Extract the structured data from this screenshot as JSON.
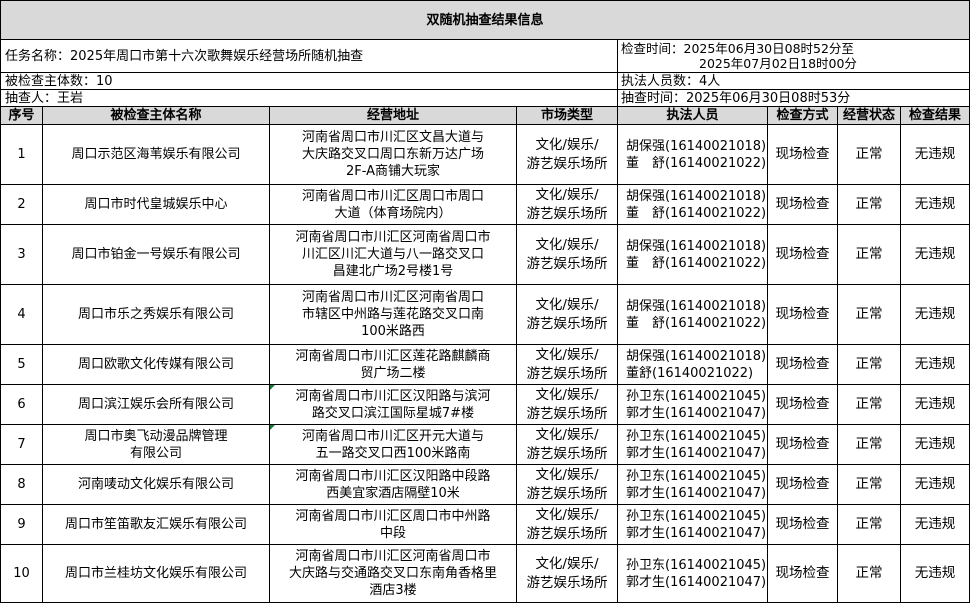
{
  "title": "双随机抽查结果信息",
  "info": {
    "task": "任务名称：2025年周口市第十六次歌舞娱乐经营场所随机抽查",
    "check_time_line1": "检查时间：2025年06月30日08时52分至",
    "check_time_line2": "2025年07月02日18时00分",
    "subjects": "被检查主体数：10",
    "officers": "执法人员数：4人",
    "drawer": "抽查人：王岩",
    "draw_time": "抽查时间：2025年06月30日08时53分"
  },
  "columns": [
    "序号",
    "被检查主体名称",
    "经营地址",
    "市场类型",
    "执法人员",
    "检查方式",
    "经营状态",
    "检查结果"
  ],
  "rows": [
    {
      "no": "1",
      "name": "周口示范区海苇娱乐有限公司",
      "addr": [
        "河南省周口市川汇区文昌大道与",
        "大庆路交叉口周口东新万达广场",
        "2F-A商铺大玩家"
      ],
      "market": [
        "文化/娱乐/",
        "游艺娱乐场所"
      ],
      "officers": [
        "胡保强(16140021018)",
        "董　舒(16140021022)"
      ],
      "method": "现场检查",
      "status": "正常",
      "result": "无违规"
    },
    {
      "no": "2",
      "name": "周口市时代皇城娱乐中心",
      "addr": [
        "河南省周口市川汇区周口市周口",
        "大道（体育场院内）"
      ],
      "market": [
        "文化/娱乐/",
        "游艺娱乐场所"
      ],
      "officers": [
        "胡保强(16140021018)",
        "董　舒(16140021022)"
      ],
      "method": "现场检查",
      "status": "正常",
      "result": "无违规"
    },
    {
      "no": "3",
      "name": "周口市铂金一号娱乐有限公司",
      "addr": [
        "河南省周口市川汇区河南省周口市",
        "川汇区川汇大道与八一路交叉口",
        "昌建北广场2号楼1号"
      ],
      "market": [
        "文化/娱乐/",
        "游艺娱乐场所"
      ],
      "officers": [
        "胡保强(16140021018)",
        "董　舒(16140021022)"
      ],
      "method": "现场检查",
      "status": "正常",
      "result": "无违规"
    },
    {
      "no": "4",
      "name": "周口市乐之秀娱乐有限公司",
      "addr": [
        "河南省周口市川汇区河南省周口",
        "市辖区中州路与莲花路交叉口南",
        "100米路西"
      ],
      "market": [
        "文化/娱乐/",
        "游艺娱乐场所"
      ],
      "officers": [
        "胡保强(16140021018)",
        "董　舒(16140021022)"
      ],
      "method": "现场检查",
      "status": "正常",
      "result": "无违规"
    },
    {
      "no": "5",
      "name": "周口欧歌文化传媒有限公司",
      "addr": [
        "河南省周口市川汇区莲花路麒麟商",
        "贸广场二楼"
      ],
      "market": [
        "文化/娱乐/",
        "游艺娱乐场所"
      ],
      "officers": [
        "胡保强(16140021018)",
        "董舒(16140021022)"
      ],
      "method": "现场检查",
      "status": "正常",
      "result": "无违规"
    },
    {
      "no": "6",
      "name": "周口滨江娱乐会所有限公司",
      "addr": [
        "河南省周口市川汇区汉阳路与滨河",
        "路交叉口滨江国际星城7#楼"
      ],
      "market": [
        "文化/娱乐/",
        "游艺娱乐场所"
      ],
      "officers": [
        "孙卫东(16140021045)",
        "郭才生(16140021047)"
      ],
      "method": "现场检查",
      "status": "正常",
      "result": "无违规"
    },
    {
      "no": "7",
      "name": "周口市奥飞动漫品牌管理\n有限公司",
      "addr": [
        "河南省周口市川汇区开元大道与",
        "五一路交叉口西100米路南"
      ],
      "market": [
        "文化/娱乐/",
        "游艺娱乐场所"
      ],
      "officers": [
        "孙卫东(16140021045)",
        "郭才生(16140021047)"
      ],
      "method": "现场检查",
      "status": "正常",
      "result": "无违规"
    },
    {
      "no": "8",
      "name": "河南唛动文化娱乐有限公司",
      "addr": [
        "河南省周口市川汇区汉阳路中段路",
        "西美宜家酒店隔壁10米"
      ],
      "market": [
        "文化/娱乐/",
        "游艺娱乐场所"
      ],
      "officers": [
        "孙卫东(16140021045)",
        "郭才生(16140021047)"
      ],
      "method": "现场检查",
      "status": "正常",
      "result": "无违规"
    },
    {
      "no": "9",
      "name": "周口市笙笛歌友汇娱乐有限公司",
      "addr": [
        "河南省周口市川汇区周口市中州路",
        "中段"
      ],
      "market": [
        "文化/娱乐/",
        "游艺娱乐场所"
      ],
      "officers": [
        "孙卫东(16140021045)",
        "郭才生(16140021047)"
      ],
      "method": "现场检查",
      "status": "正常",
      "result": "无违规"
    },
    {
      "no": "10",
      "name": "周口市兰桂坊文化娱乐有限公司",
      "addr": [
        "河南省周口市川汇区河南省周口市",
        "大庆路与交通路交叉口东南角香格里",
        "酒店3楼"
      ],
      "market": [
        "文化/娱乐/",
        "游艺娱乐场所"
      ],
      "officers": [
        "孙卫东(16140021045)",
        "郭才生(16140021047)"
      ],
      "method": "现场检查",
      "status": "正常",
      "result": "无违规"
    }
  ]
}
